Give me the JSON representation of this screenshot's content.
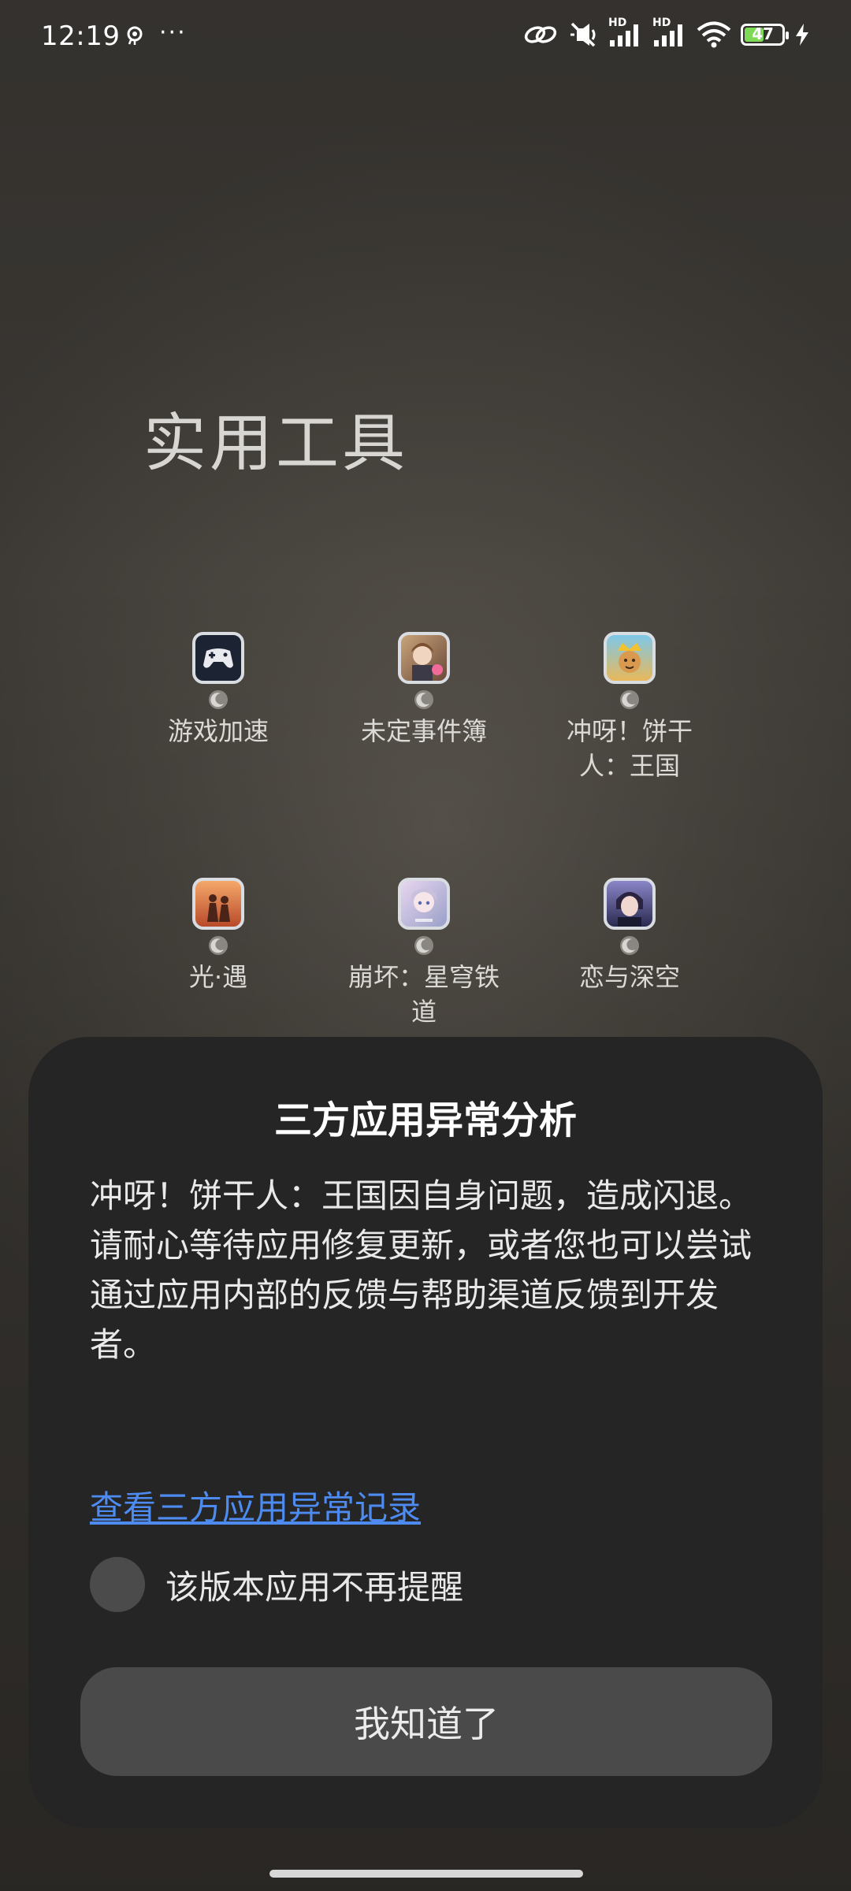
{
  "status_bar": {
    "time": "12:19",
    "more": "···",
    "battery_level": "47",
    "left_icons": [
      "ai-assistant-icon"
    ],
    "right_icons": [
      "link-icon",
      "mute-icon",
      "signal-hd-icon",
      "signal-hd-icon",
      "wifi-icon",
      "battery-icon",
      "charging-icon"
    ],
    "hd_label": "HD"
  },
  "folder": {
    "title": "实用工具",
    "apps": [
      {
        "label": "游戏加速",
        "icon": "gamepad-icon"
      },
      {
        "label": "未定事件簿",
        "icon": "app-icon"
      },
      {
        "label": "冲呀！饼干人：王国",
        "icon": "app-icon"
      },
      {
        "label": "光·遇",
        "icon": "app-icon"
      },
      {
        "label": "崩坏：星穹铁道",
        "icon": "app-icon"
      },
      {
        "label": "恋与深空",
        "icon": "app-icon"
      }
    ]
  },
  "dialog": {
    "title": "三方应用异常分析",
    "message_line1": "冲呀！饼干人：王国因自身问题，造成闪退。",
    "message_line2": "请耐心等待应用修复更新，或者您也可以尝试通过应用内部的反馈与帮助渠道反馈到开发者。",
    "link": "查看三方应用异常记录",
    "checkbox_label": "该版本应用不再提醒",
    "button": "我知道了"
  },
  "colors": {
    "dialog_bg": "#252525",
    "link": "#4e8bf0",
    "button_bg": "#4a4a4a",
    "battery_fill": "#7ed957"
  }
}
